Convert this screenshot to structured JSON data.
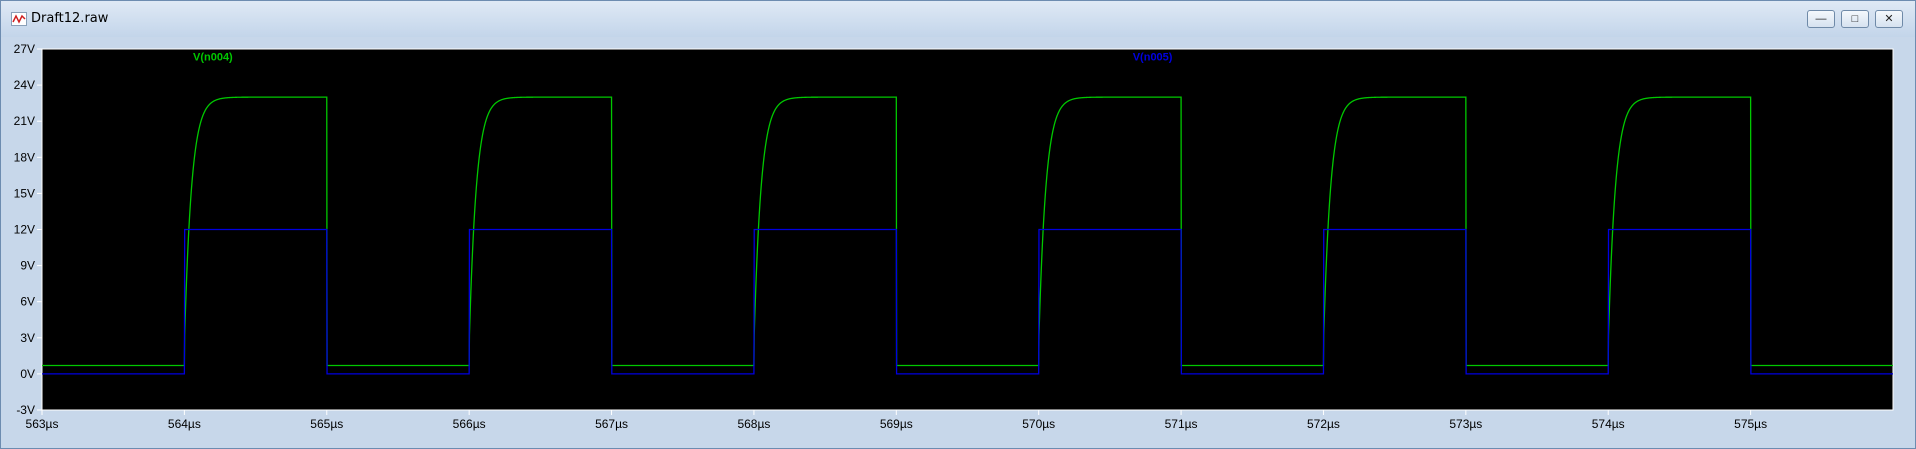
{
  "window": {
    "title": "Draft12.raw",
    "minimize_label": "—",
    "maximize_label": "□",
    "close_label": "✕"
  },
  "colors": {
    "background": "#000000",
    "axis": "#ffffff",
    "series_1": "#00c800",
    "series_2": "#0000e0"
  },
  "chart_data": {
    "type": "line",
    "xlabel": "",
    "ylabel": "",
    "xlim": [
      563,
      576.0
    ],
    "ylim": [
      -3,
      27
    ],
    "x_ticks": [
      "563µs",
      "564µs",
      "565µs",
      "566µs",
      "567µs",
      "568µs",
      "569µs",
      "570µs",
      "571µs",
      "572µs",
      "573µs",
      "574µs",
      "575µs"
    ],
    "y_ticks": [
      "-3V",
      "0V",
      "3V",
      "6V",
      "9V",
      "12V",
      "15V",
      "18V",
      "21V",
      "24V",
      "27V"
    ],
    "grid": false,
    "series": [
      {
        "name": "V(n004)",
        "color": "#00c800",
        "pulse": {
          "period_us": 2.0,
          "high_start_us": 564.0,
          "high_end_us": 565.0,
          "low_v": 0.7,
          "high_v": 23.0,
          "rise_tau_us": 0.05
        }
      },
      {
        "name": "V(n005)",
        "color": "#0000e0",
        "pulse": {
          "period_us": 2.0,
          "high_start_us": 564.0,
          "high_end_us": 565.0,
          "low_v": 0.0,
          "high_v": 12.0
        }
      }
    ]
  }
}
